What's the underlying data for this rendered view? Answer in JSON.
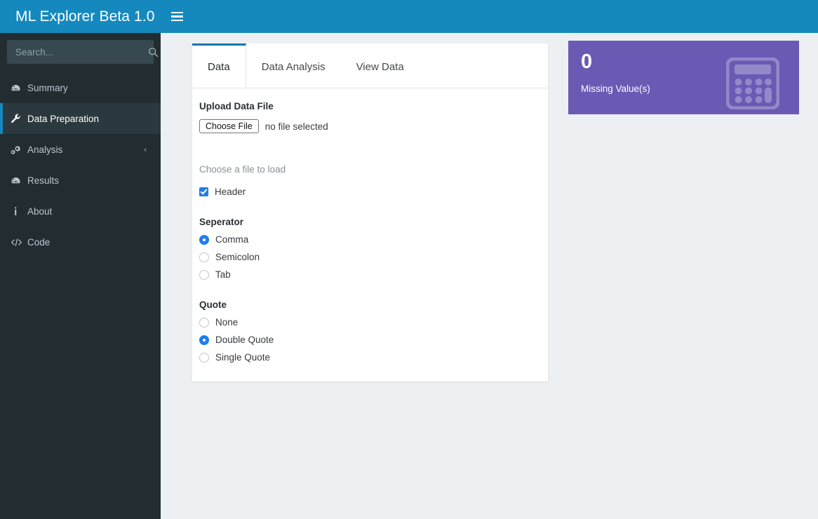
{
  "header": {
    "title": "ML Explorer Beta 1.0",
    "menu_toggle_icon": "hamburger-icon",
    "accent_color": "#1589be"
  },
  "sidebar": {
    "background_color": "#222d32",
    "search": {
      "placeholder": "Search...",
      "value": "",
      "icon": "search-icon"
    },
    "items": [
      {
        "label": "Summary",
        "icon": "tachometer-icon",
        "active": false,
        "chevron": ""
      },
      {
        "label": "Data Preparation",
        "icon": "wrench-icon",
        "active": true,
        "chevron": ""
      },
      {
        "label": "Analysis",
        "icon": "cogs-icon",
        "active": false,
        "chevron": "‹"
      },
      {
        "label": "Results",
        "icon": "tachometer-icon",
        "active": false,
        "chevron": ""
      },
      {
        "label": "About",
        "icon": "info-icon",
        "active": false,
        "chevron": ""
      },
      {
        "label": "Code",
        "icon": "code-icon",
        "active": false,
        "chevron": ""
      }
    ]
  },
  "main": {
    "tabs": [
      {
        "label": "Data",
        "active": true
      },
      {
        "label": "Data Analysis",
        "active": false
      },
      {
        "label": "View Data",
        "active": false
      }
    ],
    "upload": {
      "title": "Upload Data File",
      "button_label": "Choose File",
      "file_status": "no file selected",
      "hint": "Choose a file to load"
    },
    "header_option": {
      "label": "Header",
      "checked": true
    },
    "separator": {
      "title": "Seperator",
      "options": [
        {
          "label": "Comma",
          "selected": true
        },
        {
          "label": "Semicolon",
          "selected": false
        },
        {
          "label": "Tab",
          "selected": false
        }
      ]
    },
    "quote": {
      "title": "Quote",
      "options": [
        {
          "label": "None",
          "selected": false
        },
        {
          "label": "Double Quote",
          "selected": true
        },
        {
          "label": "Single Quote",
          "selected": false
        }
      ]
    }
  },
  "stat_box": {
    "value": "0",
    "label": "Missing Value(s)",
    "icon": "calculator-icon",
    "background_color": "#6a5ab4"
  }
}
